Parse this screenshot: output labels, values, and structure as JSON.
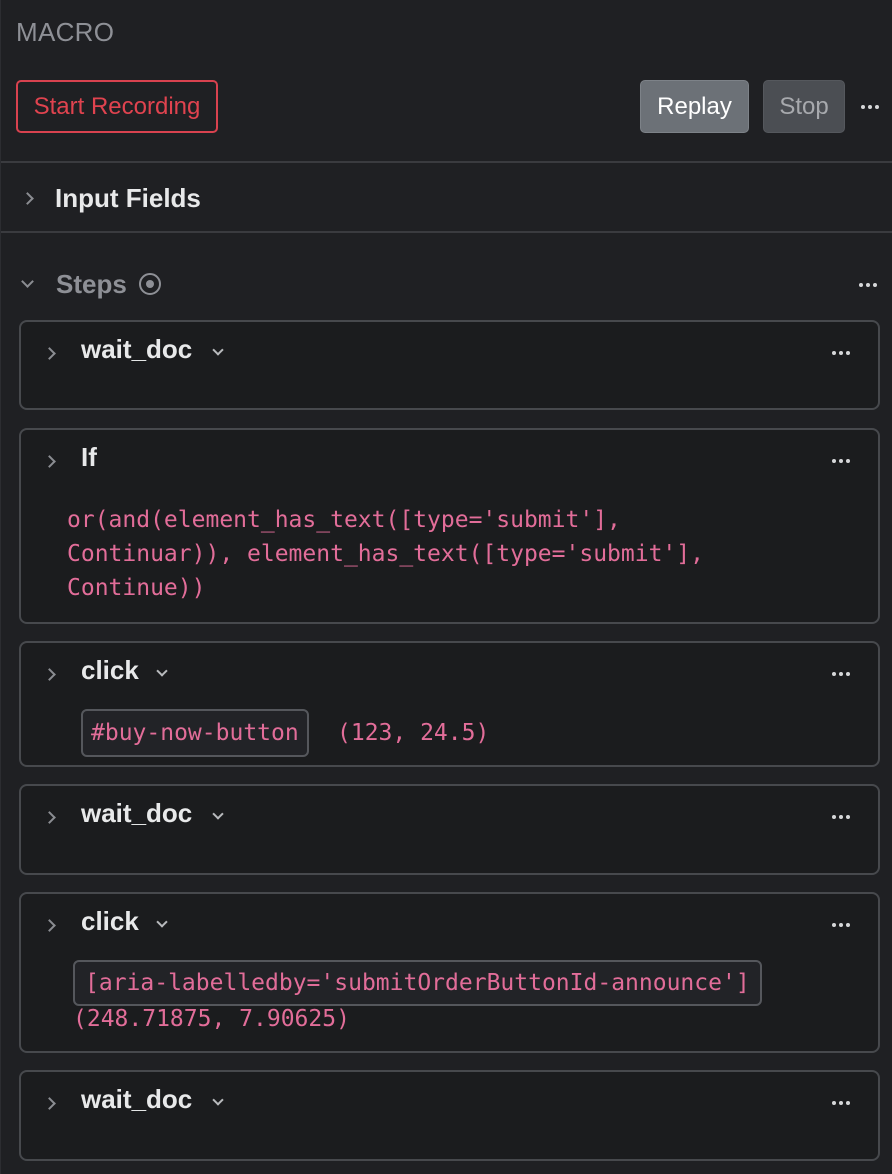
{
  "panel": {
    "title": "MACRO"
  },
  "toolbar": {
    "record_label": "Start Recording",
    "replay_label": "Replay",
    "stop_label": "Stop",
    "menu_icon": "more-horizontal-icon"
  },
  "sections": {
    "input_fields": {
      "label": "Input Fields",
      "expanded": false
    },
    "steps": {
      "label": "Steps",
      "expanded": true,
      "status_icon": "record-circle-icon"
    }
  },
  "steps": [
    {
      "name": "wait_doc",
      "has_dropdown": true
    },
    {
      "name": "If",
      "has_dropdown": false,
      "condition_lines": [
        "or(and(element_has_text([type='submit'],",
        "Continuar)), element_has_text([type='submit'],",
        "Continue))"
      ]
    },
    {
      "name": "click",
      "has_dropdown": true,
      "selector": "#buy-now-button",
      "coords": "(123, 24.5)"
    },
    {
      "name": "wait_doc",
      "has_dropdown": true
    },
    {
      "name": "click",
      "has_dropdown": true,
      "selector": "[aria-labelledby='submitOrderButtonId-announce']",
      "coords": "(248.71875, 7.90625)"
    },
    {
      "name": "wait_doc",
      "has_dropdown": true
    }
  ],
  "colors": {
    "background": "#1f2023",
    "record_accent": "#e0434f",
    "code_text": "#e26d99",
    "card_border": "#47494d"
  }
}
